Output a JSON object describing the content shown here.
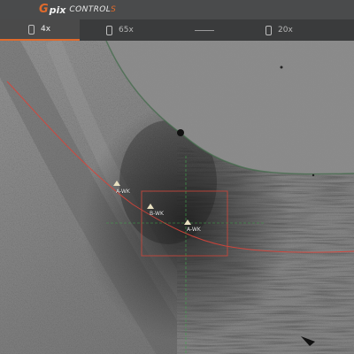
{
  "app": {
    "brand_g": "G",
    "brand_pix": "pix",
    "brand_control": "CONTROL",
    "brand_s": "S"
  },
  "tabs": [
    {
      "label": "4x",
      "active": true
    },
    {
      "label": "65x",
      "active": false
    },
    {
      "label": "",
      "active": false
    },
    {
      "label": "20x",
      "active": false
    }
  ],
  "markers": [
    {
      "label": "A-WK"
    },
    {
      "label": "B-WK"
    },
    {
      "label": "A-WK"
    }
  ],
  "colors": {
    "accent": "#e06a2c",
    "topbar": "#4a4b4c",
    "tabbar": "#3a3b3c",
    "guide_red": "#d9443a",
    "guide_green": "#3fa34a"
  }
}
